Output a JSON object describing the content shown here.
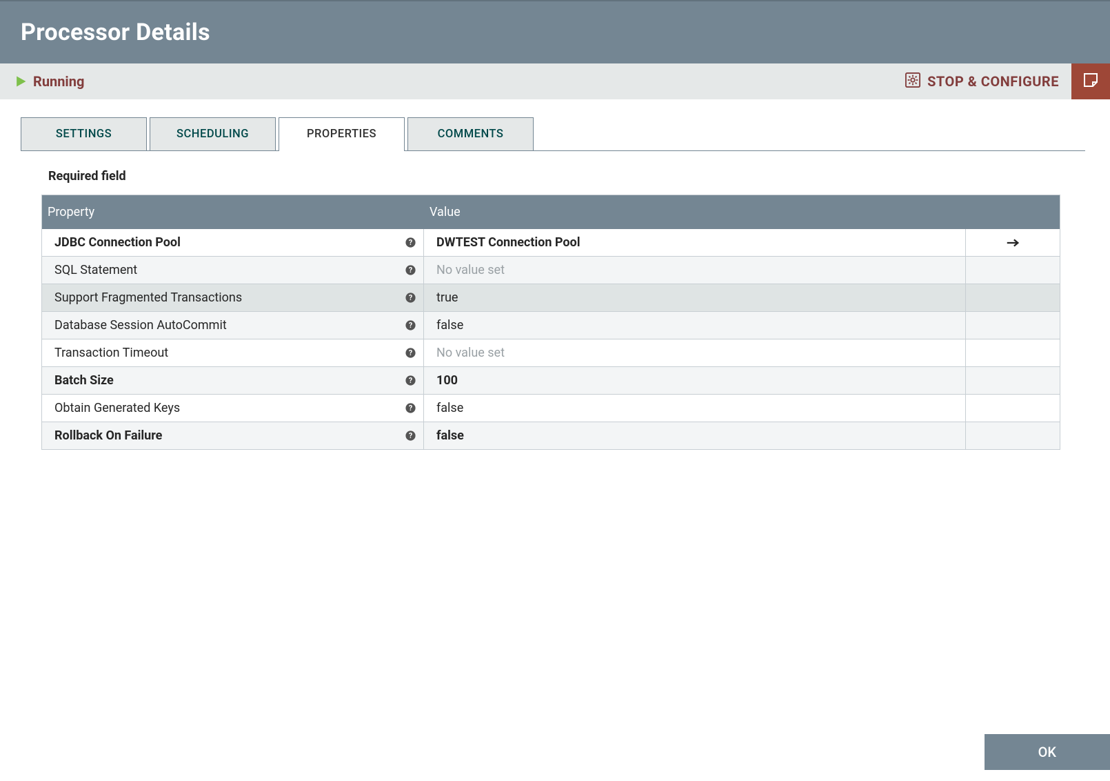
{
  "header": {
    "title": "Processor Details"
  },
  "status": {
    "state": "Running",
    "stop_configure": "STOP & CONFIGURE"
  },
  "tabs": {
    "settings": "SETTINGS",
    "scheduling": "SCHEDULING",
    "properties": "PROPERTIES",
    "comments": "COMMENTS"
  },
  "section_label": "Required field",
  "table": {
    "header_property": "Property",
    "header_value": "Value",
    "rows": [
      {
        "name": "JDBC Connection Pool",
        "value": "DWTEST Connection Pool",
        "bold": true,
        "muted": false,
        "goto": true,
        "highlight": false
      },
      {
        "name": "SQL Statement",
        "value": "No value set",
        "bold": false,
        "muted": true,
        "goto": false,
        "highlight": false
      },
      {
        "name": "Support Fragmented Transactions",
        "value": "true",
        "bold": false,
        "muted": false,
        "goto": false,
        "highlight": true
      },
      {
        "name": "Database Session AutoCommit",
        "value": "false",
        "bold": false,
        "muted": false,
        "goto": false,
        "highlight": false
      },
      {
        "name": "Transaction Timeout",
        "value": "No value set",
        "bold": false,
        "muted": true,
        "goto": false,
        "highlight": false
      },
      {
        "name": "Batch Size",
        "value": "100",
        "bold": true,
        "muted": false,
        "goto": false,
        "highlight": false
      },
      {
        "name": "Obtain Generated Keys",
        "value": "false",
        "bold": false,
        "muted": false,
        "goto": false,
        "highlight": false
      },
      {
        "name": "Rollback On Failure",
        "value": "false",
        "bold": true,
        "muted": false,
        "goto": false,
        "highlight": false
      }
    ]
  },
  "footer": {
    "ok": "OK"
  }
}
